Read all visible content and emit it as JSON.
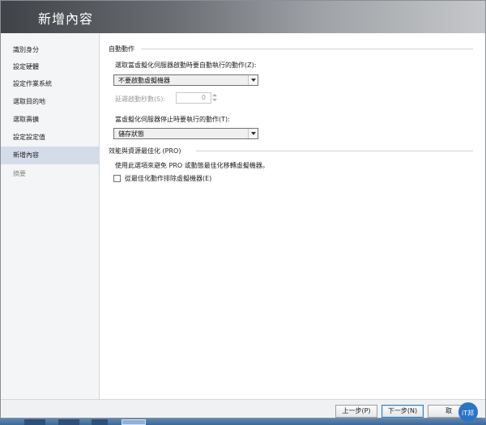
{
  "header": {
    "title": "新增內容"
  },
  "nav": {
    "items": [
      {
        "label": "識別身分"
      },
      {
        "label": "設定硬體"
      },
      {
        "label": "設定作業系統"
      },
      {
        "label": "選取目的地"
      },
      {
        "label": "選取壽擴"
      },
      {
        "label": "設定設定值"
      },
      {
        "label": "新增內容"
      },
      {
        "label": "摘要"
      }
    ]
  },
  "content": {
    "auto_actions": {
      "heading": "自動動作",
      "start_label": "選取當虛擬化伺服器啟動時要自動執行的動作(Z):",
      "start_value": "不要啟動虛擬機器",
      "delay_label": "延遲啟動秒數(S):",
      "delay_value": "0",
      "stop_label": "當虛擬化伺服器停止時要執行的動作(T):",
      "stop_value": "儲存狀態"
    },
    "pro": {
      "heading": "效能與資源最佳化 (PRO)",
      "description": "使用此選項來避免 PRO 或動態最佳化移轉虛擬機器。",
      "checkbox_label": "從最佳化動作排除虛擬機器(E)"
    }
  },
  "footer": {
    "back_label": "上一步(P)",
    "next_label": "下一步(N)",
    "cancel_label": "取"
  },
  "watermark": {
    "text": "iT邦",
    "subtext": "幫忙"
  },
  "colors": {
    "header_start": "#3f4247",
    "header_end": "#c6c8cb",
    "nav_active": "#d4dcea",
    "taskbar": "#4a75a5"
  }
}
